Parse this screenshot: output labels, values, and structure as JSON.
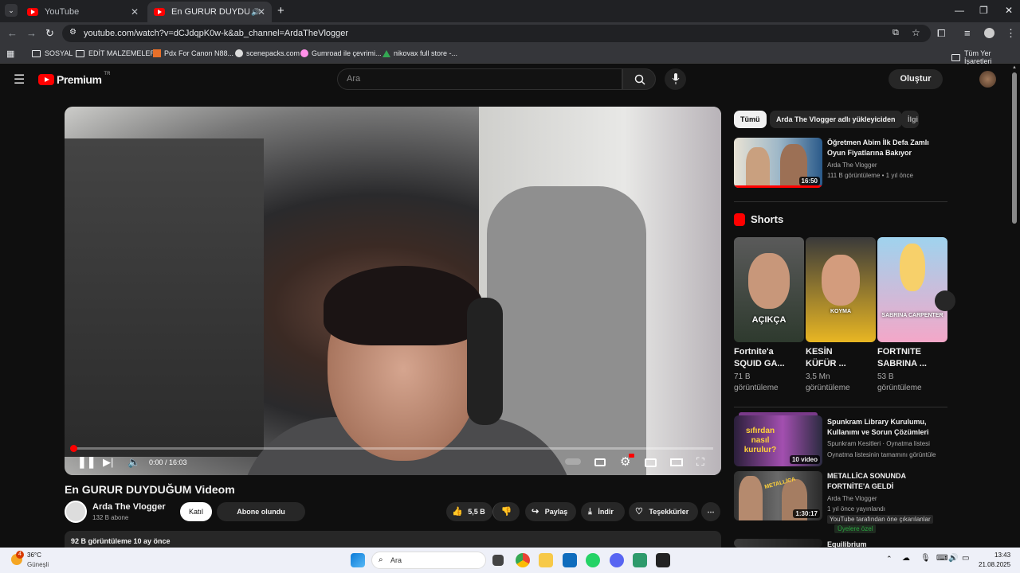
{
  "browser": {
    "tabs": [
      {
        "label": "YouTube"
      },
      {
        "label": "En GURUR DUYDUĞUM Vi"
      }
    ],
    "url": "youtube.com/watch?v=dCJdqpK0w-k&ab_channel=ArdaTheVlogger",
    "bookmarks": [
      {
        "label": "SOSYAL"
      },
      {
        "label": "EDİT MALZEMELERİ"
      },
      {
        "label": "Pdx For Canon N88..."
      },
      {
        "label": "scenepacks.com"
      },
      {
        "label": "Gumroad ile çevrimi..."
      },
      {
        "label": "nikovax full store -..."
      }
    ],
    "all_bookmarks": "Tüm Yer İşaretleri"
  },
  "header": {
    "logo_text": "Premium",
    "logo_sup": "TR",
    "search_placeholder": "Ara",
    "create_label": "Oluştur"
  },
  "player": {
    "time": "0:00 / 16:03",
    "progress": 0.0
  },
  "video": {
    "title": "En GURUR DUYDUĞUM Videom",
    "channel": "Arda The Vlogger",
    "subscribers": "132 B abone",
    "join_label": "Katıl",
    "subscribed_label": "Abone olundu",
    "likes": "5,5 B",
    "share_label": "Paylaş",
    "download_label": "İndir",
    "thanks_label": "Teşekkürler",
    "views_date": "92 B görüntüleme  10 ay önce"
  },
  "sidebar": {
    "chips": [
      {
        "label": "Tümü"
      },
      {
        "label": "Arda The Vlogger adlı yükleyiciden"
      },
      {
        "label": "İlgi"
      }
    ],
    "top_video": {
      "title_line1": "Öğretmen Abim İlk Defa Zamlı",
      "title_line2": "Oyun Fiyatlarına Bakıyor",
      "channel": "Arda The Vlogger",
      "meta": "111 B görüntüleme • 1 yıl önce",
      "duration": "16:50"
    },
    "shorts_heading": "Shorts",
    "shorts": [
      {
        "t1": "Fortnite'a",
        "t2": "SQUID GA...",
        "v1": "71 B",
        "v2": "görüntüleme",
        "overlay": "AÇIKÇA"
      },
      {
        "t1": "KESİN",
        "t2": "KÜFÜR ...",
        "v1": "3,5 Mn",
        "v2": "görüntüleme",
        "overlay": "KOYMA"
      },
      {
        "t1": "FORTNITE",
        "t2": "SABRINA ...",
        "v1": "53 B",
        "v2": "görüntüleme",
        "overlay": "SABRINA CARPENTER"
      }
    ],
    "playlist": {
      "title_line1": "Spunkram Library Kurulumu,",
      "title_line2": "Kullanımı ve Sorun Çözümleri",
      "channel": "Spunkram Kesitleri · Oynatma listesi",
      "meta": "Oynatma listesinin tamamını görüntüle",
      "badge": "10 video",
      "thumb_text": "sıfırdan nasıl kurulur?"
    },
    "video2": {
      "title_line1": "METALLİCA SONUNDA",
      "title_line2": "FORTNİTE'A GELDİ",
      "channel": "Arda The Vlogger",
      "meta": "1 yıl önce yayınlandı",
      "tag1": "YouTube tarafından öne çıkarılanlar",
      "tag2": "Üyelere özel",
      "duration": "1:30:17",
      "thumb_text": "METALLİCA"
    },
    "video3": {
      "title_line1": "Equilibrium"
    }
  },
  "taskbar": {
    "weather_temp": "36°C",
    "weather_desc": "Güneşli",
    "weather_badge": "4",
    "search_label": "Ara",
    "time": "13:43",
    "date": "21.08.2025"
  }
}
